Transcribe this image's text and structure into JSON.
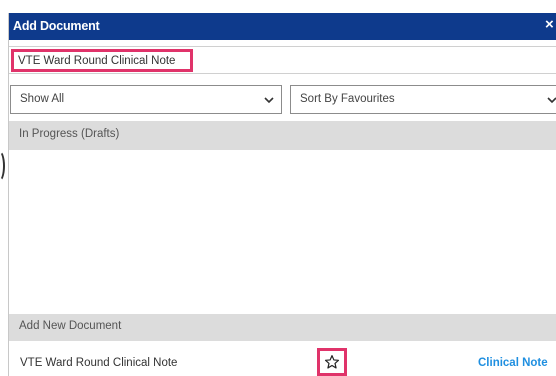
{
  "dialog": {
    "title": "Add Document",
    "close_glyph": "×"
  },
  "search": {
    "value": "VTE Ward Round Clinical Note"
  },
  "filters": {
    "show_filter": "Show All",
    "sort_filter": "Sort By Favourites"
  },
  "sections": {
    "in_progress": "In Progress (Drafts)",
    "add_new": "Add New Document"
  },
  "documents": [
    {
      "name": "VTE Ward Round Clinical Note",
      "type": "Clinical Note",
      "favourite": false,
      "icon": "star-outline-icon"
    }
  ],
  "colors": {
    "titlebar": "#0e3a8c",
    "highlight": "#e0336a",
    "link": "#1f8fe0",
    "section_bg": "#dcdcdc"
  }
}
